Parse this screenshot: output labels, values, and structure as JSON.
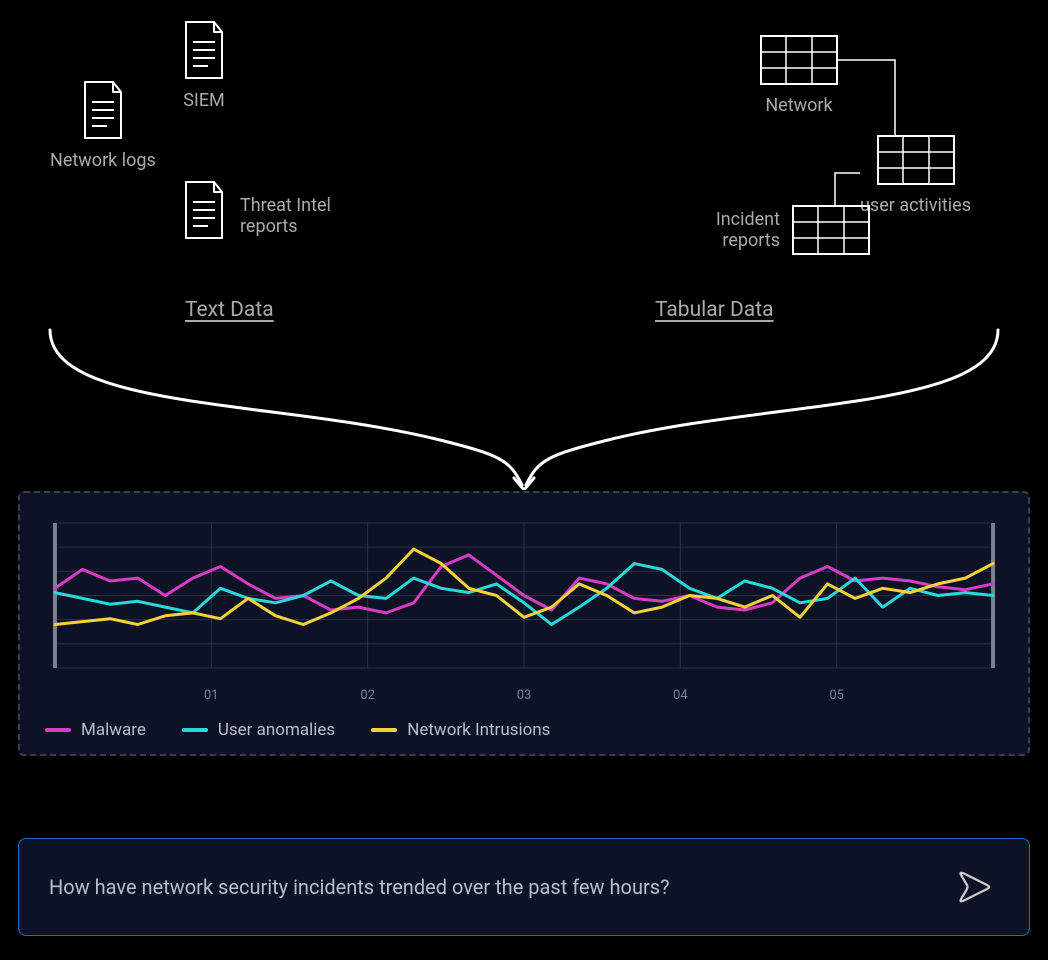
{
  "text_data": {
    "title": "Text Data",
    "sources": {
      "network_logs": "Network logs",
      "siem": "SIEM",
      "threat_intel": "Threat Intel reports"
    }
  },
  "tabular_data": {
    "title": "Tabular Data",
    "sources": {
      "network": "Network",
      "user_activities": "user activities",
      "incident_reports": "Incident reports"
    }
  },
  "chart_data": {
    "type": "line",
    "x_ticks": [
      "01",
      "02",
      "03",
      "04",
      "05"
    ],
    "ylim": [
      0,
      100
    ],
    "legend_position": "bottom",
    "series": [
      {
        "name": "Malware",
        "color": "#d63cc4",
        "values": [
          55,
          68,
          60,
          62,
          50,
          62,
          70,
          58,
          48,
          50,
          40,
          42,
          38,
          45,
          70,
          78,
          64,
          50,
          40,
          62,
          58,
          48,
          46,
          50,
          42,
          40,
          45,
          62,
          70,
          60,
          62,
          60,
          56,
          54,
          58
        ]
      },
      {
        "name": "User anomalies",
        "color": "#29d8d8",
        "values": [
          52,
          48,
          44,
          46,
          42,
          38,
          55,
          48,
          45,
          50,
          60,
          50,
          48,
          62,
          55,
          52,
          58,
          45,
          30,
          42,
          55,
          72,
          68,
          55,
          48,
          60,
          55,
          45,
          48,
          62,
          42,
          55,
          50,
          52,
          50
        ]
      },
      {
        "name": "Network Intrusions",
        "color": "#f5d23b",
        "values": [
          30,
          32,
          34,
          30,
          36,
          38,
          34,
          48,
          36,
          30,
          38,
          48,
          62,
          82,
          72,
          55,
          50,
          35,
          42,
          58,
          50,
          38,
          42,
          50,
          48,
          42,
          50,
          35,
          58,
          48,
          55,
          52,
          58,
          62,
          72
        ]
      }
    ]
  },
  "prompt": {
    "text": "How have network security incidents trended over the past few hours?"
  },
  "colors": {
    "bg_panel": "#0d1324",
    "border_prompt": "#2a6bc9",
    "text_muted": "#aaa"
  }
}
